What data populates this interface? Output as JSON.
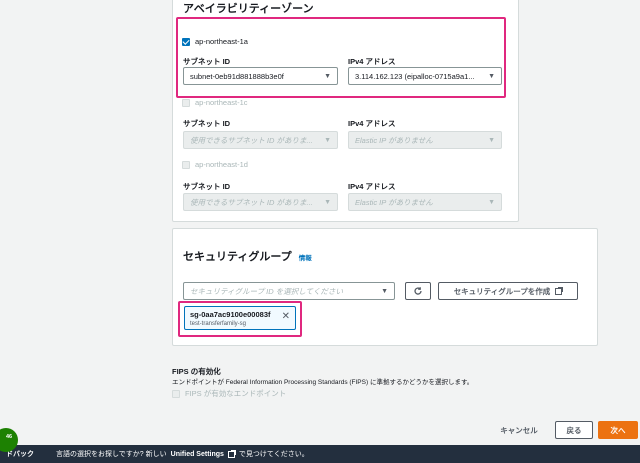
{
  "az_section": {
    "title": "アベイラビリティーゾーン",
    "zones": [
      {
        "name": "ap-northeast-1a",
        "checked": true,
        "subnet_label": "サブネット ID",
        "subnet_value": "subnet-0eb91d881888b3e0f",
        "ipv4_label": "IPv4 アドレス",
        "ipv4_value": "3.114.162.123 (eipalloc-0715a9a1..."
      },
      {
        "name": "ap-northeast-1c",
        "checked": false,
        "subnet_label": "サブネット ID",
        "subnet_value": "使用できるサブネット ID がありま...",
        "ipv4_label": "IPv4 アドレス",
        "ipv4_value": "Elastic IP がありません"
      },
      {
        "name": "ap-northeast-1d",
        "checked": false,
        "subnet_label": "サブネット ID",
        "subnet_value": "使用できるサブネット ID がありま...",
        "ipv4_label": "IPv4 アドレス",
        "ipv4_value": "Elastic IP がありません"
      }
    ]
  },
  "sg_section": {
    "title": "セキュリティグループ",
    "info_link": "情報",
    "select_placeholder": "セキュリティグループ ID を選択してください",
    "create_button": "セキュリティグループを作成",
    "selected_id": "sg-0aa7ac9100e00083f",
    "selected_name": "test-transferfamily-sg"
  },
  "fips": {
    "title": "FIPS の有効化",
    "description": "エンドポイントが Federal Information Processing Standards (FIPS) に準拠するかどうかを選択します。",
    "checkbox_label": "FIPS が有効なエンドポイント"
  },
  "footer_buttons": {
    "cancel": "キャンセル",
    "back": "戻る",
    "next": "次へ"
  },
  "bottom_bar": {
    "feedback": "ドバック",
    "message_prefix": "言語の選択をお探しですか? 新しい",
    "settings_link": "Unified Settings",
    "message_suffix": "で見つけてください。",
    "badge_count": "46"
  },
  "colors": {
    "highlight": "#e0287f",
    "primary": "#ec7211",
    "link": "#0073bb",
    "bottom_bar": "#232f3e"
  }
}
